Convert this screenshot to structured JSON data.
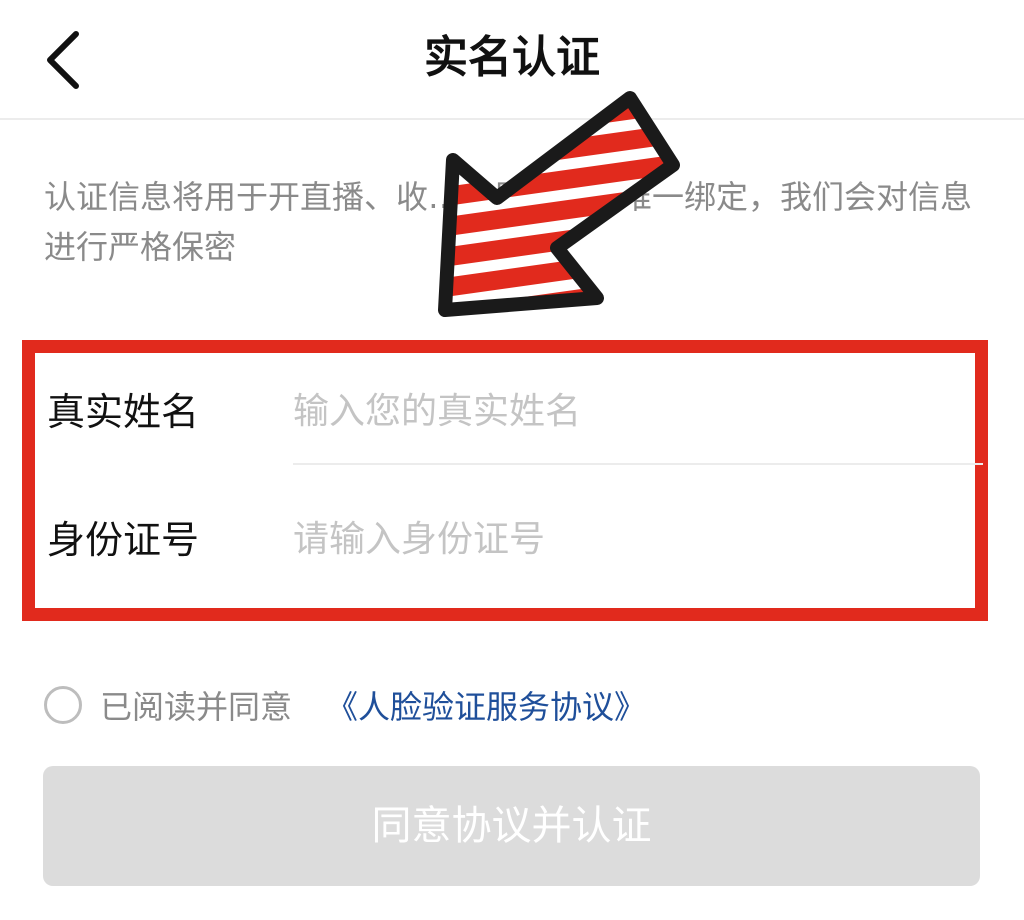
{
  "header": {
    "title": "实名认证",
    "back_icon": "chevron-left-icon"
  },
  "description": "认证信息将用于开直播、收……号与帐号唯一绑定，我们会对信息进行严格保密",
  "annotation": {
    "arrow_icon": "pointer-arrow-icon",
    "arrow_color": "#e12a1d",
    "highlight_color": "#e12a1d"
  },
  "form": {
    "name_label": "真实姓名",
    "name_placeholder": "输入您的真实姓名",
    "name_value": "",
    "id_label": "身份证号",
    "id_placeholder": "请输入身份证号",
    "id_value": ""
  },
  "agreement": {
    "checked": false,
    "text": "已阅读并同意",
    "link_text": "《人脸验证服务协议》"
  },
  "submit": {
    "label": "同意协议并认证",
    "enabled": false
  },
  "colors": {
    "link": "#1f4f9a",
    "disabled_button": "#dcdcdc"
  }
}
